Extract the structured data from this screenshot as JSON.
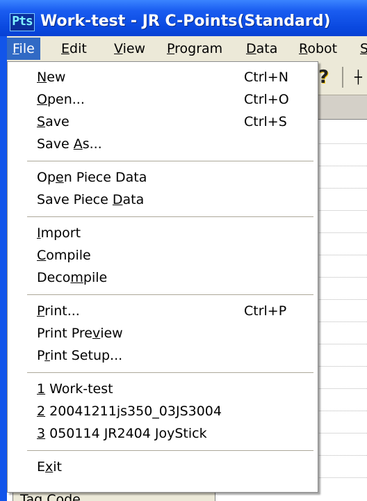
{
  "window": {
    "title": "Work-test - JR C-Points(Standard)",
    "app_icon_text": "Pts"
  },
  "menubar": {
    "items": [
      {
        "label": "File",
        "active": true
      },
      {
        "label": "Edit"
      },
      {
        "label": "View"
      },
      {
        "label": "Program"
      },
      {
        "label": "Data"
      },
      {
        "label": "Robot"
      },
      {
        "label": "S"
      }
    ]
  },
  "toolbar": {
    "help_glyph": "?",
    "partial_item_glyph": "┼"
  },
  "behind": {
    "tag_cell_text": "Tag Code"
  },
  "file_menu": {
    "items": [
      {
        "label": "New",
        "mnemonic": "N",
        "shortcut": "Ctrl+N"
      },
      {
        "label": "Open...",
        "mnemonic": "O",
        "shortcut": "Ctrl+O"
      },
      {
        "label": "Save",
        "mnemonic": "S",
        "shortcut": "Ctrl+S"
      },
      {
        "label": "Save As...",
        "mnemonic": "A",
        "shortcut": ""
      },
      {
        "separator": true
      },
      {
        "label": "Open Piece Data",
        "mnemonic": "e",
        "shortcut": ""
      },
      {
        "label": "Save Piece Data",
        "mnemonic": "D",
        "shortcut": ""
      },
      {
        "separator": true
      },
      {
        "label": "Import",
        "mnemonic": "I",
        "shortcut": ""
      },
      {
        "label": "Compile",
        "mnemonic": "C",
        "shortcut": ""
      },
      {
        "label": "Decompile",
        "mnemonic": "m",
        "shortcut": ""
      },
      {
        "separator": true
      },
      {
        "label": "Print...",
        "mnemonic": "P",
        "shortcut": "Ctrl+P"
      },
      {
        "label": "Print Preview",
        "mnemonic": "v",
        "shortcut": ""
      },
      {
        "label": "Print Setup...",
        "mnemonic": "r",
        "shortcut": ""
      },
      {
        "separator": true
      },
      {
        "label": "1 Work-test",
        "mnemonic": "1",
        "shortcut": ""
      },
      {
        "label": "2 20041211js350_03JS3004",
        "mnemonic": "2",
        "shortcut": ""
      },
      {
        "label": "3 050114 JR2404 JoyStick",
        "mnemonic": "3",
        "shortcut": ""
      },
      {
        "separator": true
      },
      {
        "label": "Exit",
        "mnemonic": "x",
        "shortcut": ""
      }
    ]
  }
}
